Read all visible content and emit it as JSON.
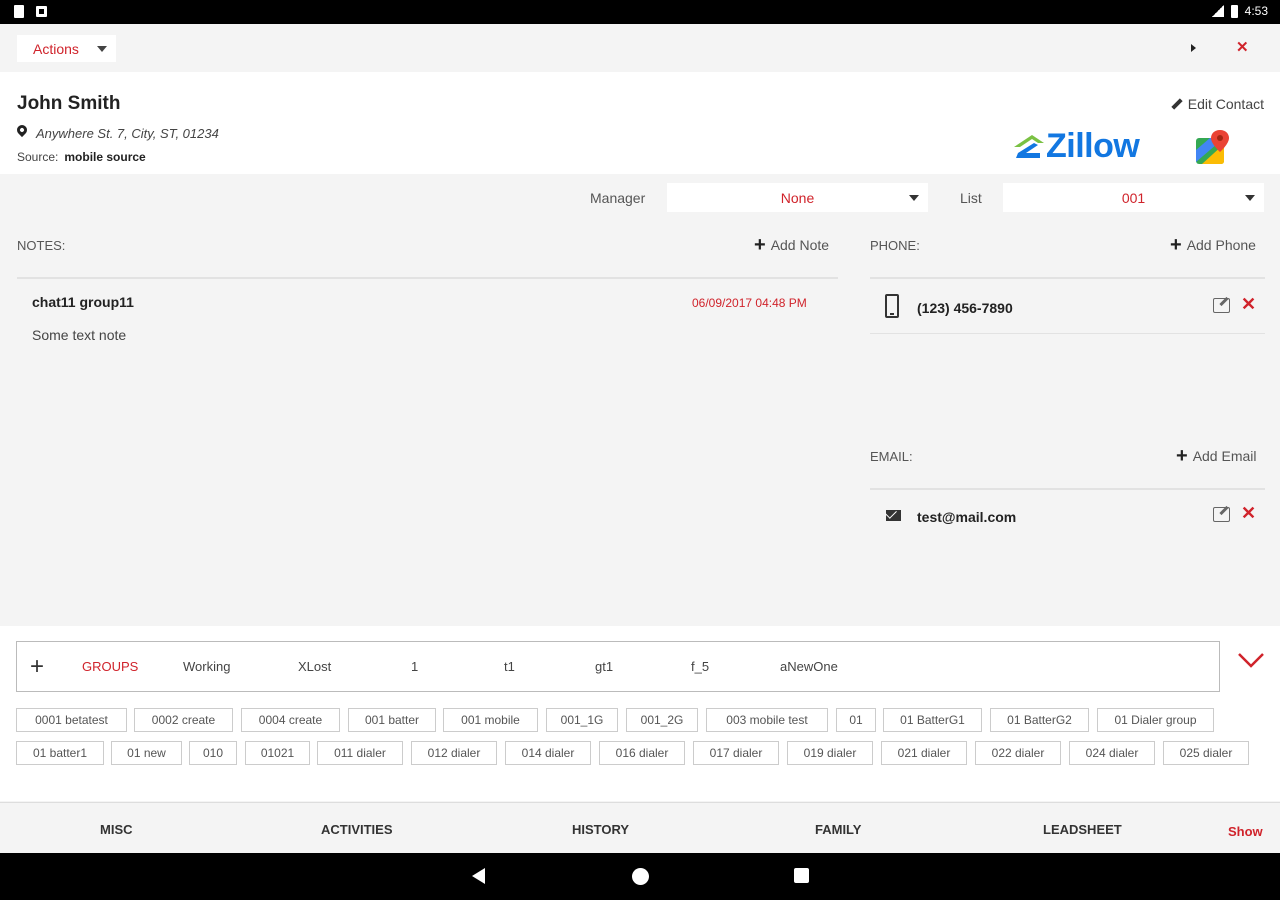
{
  "status_bar": {
    "time": "4:53"
  },
  "toolbar": {
    "actions_label": "Actions",
    "close_symbol": "✕"
  },
  "contact": {
    "name": "John Smith",
    "address": "Anywhere St. 7, City, ST, 01234",
    "source_label": "Source:",
    "source_value": "mobile source",
    "edit_label": "Edit Contact",
    "zillow_label": "Zillow"
  },
  "filters": {
    "manager_label": "Manager",
    "manager_value": "None",
    "list_label": "List",
    "list_value": "001"
  },
  "notes": {
    "title": "NOTES:",
    "add_label": "Add Note",
    "items": [
      {
        "title": "chat11 group11",
        "date": "06/09/2017 04:48 PM",
        "text": "Some text note"
      }
    ]
  },
  "phone": {
    "title": "PHONE:",
    "add_label": "Add Phone",
    "items": [
      {
        "value": "(123) 456-7890"
      }
    ]
  },
  "email": {
    "title": "EMAIL:",
    "add_label": "Add Email",
    "items": [
      {
        "value": "test@mail.com"
      }
    ]
  },
  "groups": {
    "tabs": [
      "GROUPS",
      "Working",
      "XLost",
      "1",
      "t1",
      "gt1",
      "f_5",
      "aNewOne"
    ],
    "chips_row1": [
      "0001 betatest",
      "0002 create",
      "0004 create",
      "001 batter",
      "001 mobile",
      "001_1G",
      "001_2G",
      "003 mobile test",
      "01",
      "01 BatterG1",
      "01 BatterG2",
      "01 Dialer group"
    ],
    "chips_row2": [
      "01 batter1",
      "01 new",
      "010",
      "01021",
      "011 dialer",
      "012 dialer",
      "014 dialer",
      "016 dialer",
      "017 dialer",
      "019 dialer",
      "021 dialer",
      "022 dialer",
      "024 dialer",
      "025 dialer"
    ]
  },
  "bottom_tabs": [
    "MISC",
    "ACTIVITIES",
    "HISTORY",
    "FAMILY",
    "LEADSHEET"
  ],
  "show_label": "Show",
  "colors": {
    "accent": "#d0232b",
    "zillow_blue": "#1277e1",
    "zillow_green": "#7ac143"
  }
}
